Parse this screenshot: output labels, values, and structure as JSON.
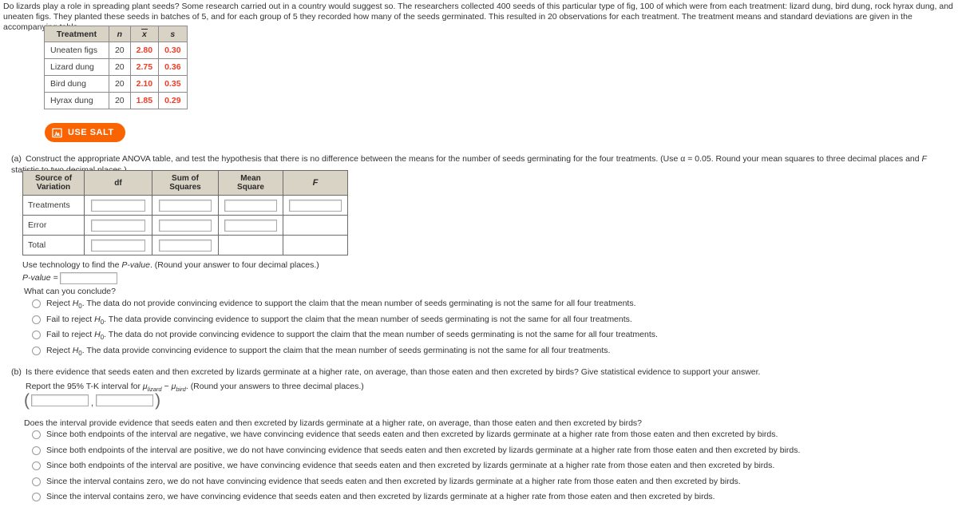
{
  "intro": {
    "paragraph": "Do lizards play a role in spreading plant seeds? Some research carried out in a country would suggest so. The researchers collected 400 seeds of this particular type of fig, 100 of which were from each treatment: lizard dung, bird dung, rock hyrax dung, and uneaten figs. They planted these seeds in batches of 5, and for each group of 5 they recorded how many of the seeds germinated. This resulted in 20 observations for each treatment. The treatment means and standard deviations are given in the accompanying table."
  },
  "summary_table": {
    "headers": [
      "Treatment",
      "n",
      "x̄",
      "s"
    ],
    "rows": [
      {
        "treatment": "Uneaten figs",
        "n": "20",
        "mean": "2.80",
        "sd": "0.30"
      },
      {
        "treatment": "Lizard dung",
        "n": "20",
        "mean": "2.75",
        "sd": "0.36"
      },
      {
        "treatment": "Bird dung",
        "n": "20",
        "mean": "2.10",
        "sd": "0.35"
      },
      {
        "treatment": "Hyrax dung",
        "n": "20",
        "mean": "1.85",
        "sd": "0.29"
      }
    ]
  },
  "salt_button": {
    "label": "USE SALT",
    "icon": "distribution-chart-icon",
    "color": "#f96302"
  },
  "part_a": {
    "label": "(a)",
    "prompt": "Construct the appropriate ANOVA table, and test the hypothesis that there is no difference between the means for the number of seeds germinating for the four treatments. (Use α = 0.05. Round your mean squares to three decimal places and F statistic to two decimal places.)",
    "anova_headers": [
      "Source of Variation",
      "df",
      "Sum of Squares",
      "Mean Square",
      "F"
    ],
    "anova_rows": [
      {
        "label": "Treatments",
        "df": "",
        "ss": "",
        "ms": "",
        "f": ""
      },
      {
        "label": "Error",
        "df": "",
        "ss": "",
        "ms": ""
      },
      {
        "label": "Total",
        "df": "",
        "ss": ""
      }
    ],
    "pvalue_instruction": "Use technology to find the P-value. (Round your answer to four decimal places.)",
    "pvalue_label": "P-value =",
    "pvalue_input": "",
    "conclude_question": "What can you conclude?",
    "options": [
      "Reject H₀. The data do not provide convincing evidence to support the claim that the mean number of seeds germinating is not the same for all four treatments.",
      "Fail to reject H₀. The data provide convincing evidence to support the claim that the mean number of seeds germinating is not the same for all four treatments.",
      "Fail to reject H₀. The data do not provide convincing evidence to support the claim that the mean number of seeds germinating is not the same for all four treatments.",
      "Reject H₀. The data provide convincing evidence to support the claim that the mean number of seeds germinating is not the same for all four treatments."
    ]
  },
  "part_b": {
    "label": "(b)",
    "prompt": "Is there evidence that seeds eaten and then excreted by lizards germinate at a higher rate, on average, than those eaten and then excreted by birds? Give statistical evidence to support your answer.",
    "tk_instruction": "Report the 95% T-K interval for μlizard − μbird. (Round your answers to three decimal places.)",
    "tk_prefix": "Report the 95% T-K interval for",
    "tk_suffix": "(Round your answers to three decimal places.)",
    "tk_mu1_sub": "lizard",
    "tk_mu2_sub": "bird",
    "interval_lower": "",
    "interval_upper": "",
    "does_question": "Does the interval provide evidence that seeds eaten and then excreted by lizards germinate at a higher rate, on average, than those eaten and then excreted by birds?",
    "options": [
      "Since both endpoints of the interval are negative, we have convincing evidence that seeds eaten and then excreted by lizards germinate at a higher rate from those eaten and then excreted by birds.",
      "Since both endpoints of the interval are positive, we do not have convincing evidence that seeds eaten and then excreted by lizards germinate at a higher rate from those eaten and then excreted by birds.",
      "Since both endpoints of the interval are positive, we have convincing evidence that seeds eaten and then excreted by lizards germinate at a higher rate from those eaten and then excreted by birds.",
      "Since the interval contains zero, we do not have convincing evidence that seeds eaten and then excreted by lizards germinate at a higher rate from those eaten and then excreted by birds.",
      "Since the interval contains zero, we have convincing evidence that seeds eaten and then excreted by lizards germinate at a higher rate from those eaten and then excreted by birds."
    ]
  }
}
